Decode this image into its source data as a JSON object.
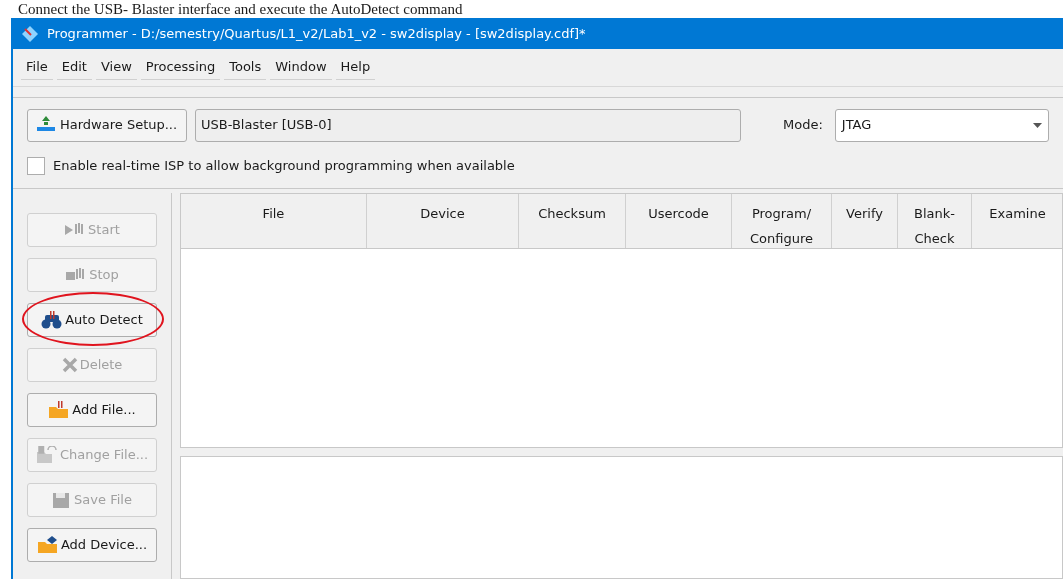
{
  "caption": "Connect the USB- Blaster interface and execute the AutoDetect command",
  "window": {
    "title": "Programmer - D:/semestry/Quartus/L1_v2/Lab1_v2 - sw2display - [sw2display.cdf]*"
  },
  "menu": [
    "File",
    "Edit",
    "View",
    "Processing",
    "Tools",
    "Window",
    "Help"
  ],
  "hardware": {
    "button": "Hardware Setup...",
    "value": "USB-Blaster [USB-0]",
    "mode_label": "Mode:",
    "mode": "JTAG"
  },
  "isp": {
    "label": "Enable real-time ISP to allow background programming when available",
    "checked": false
  },
  "actions": [
    {
      "label": "Start",
      "kind": "start",
      "disabled": true,
      "highlighted": false
    },
    {
      "label": "Stop",
      "kind": "stop",
      "disabled": true,
      "highlighted": false
    },
    {
      "label": "Auto Detect",
      "kind": "detect",
      "disabled": false,
      "highlighted": true
    },
    {
      "label": "Delete",
      "kind": "delete",
      "disabled": true,
      "highlighted": false
    },
    {
      "label": "Add File...",
      "kind": "addfile",
      "disabled": false,
      "highlighted": false
    },
    {
      "label": "Change File...",
      "kind": "change",
      "disabled": true,
      "highlighted": false
    },
    {
      "label": "Save File",
      "kind": "save",
      "disabled": true,
      "highlighted": false
    },
    {
      "label": "Add Device...",
      "kind": "adddevice",
      "disabled": false,
      "highlighted": false
    }
  ],
  "table": {
    "columns": [
      "File",
      "Device",
      "Checksum",
      "Usercode",
      "Program/ Configure",
      "Verify",
      "Blank- Check",
      "Examine"
    ]
  }
}
